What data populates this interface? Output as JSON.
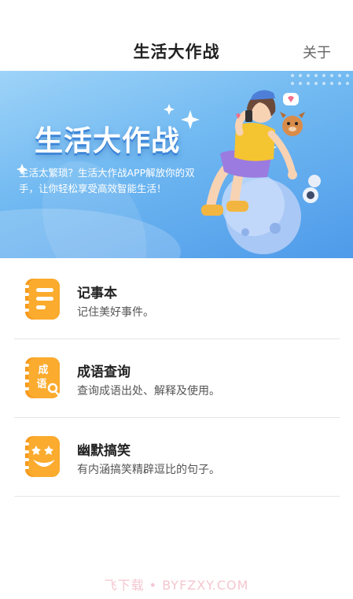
{
  "header": {
    "title": "生活大作战",
    "about_label": "关于"
  },
  "banner": {
    "title": "生活大作战",
    "desc": "生活太繁琐？生活大作战APP解放你的双手，让你轻松享受高效智能生活！"
  },
  "items": [
    {
      "title": "记事本",
      "desc": "记住美好事件。",
      "icon": "notebook-icon"
    },
    {
      "title": "成语查询",
      "desc": "查询成语出处、解释及使用。",
      "icon": "idiom-book-icon",
      "icon_text_1": "成",
      "icon_text_2": "语"
    },
    {
      "title": "幽默搞笑",
      "desc": "有内涵搞笑精辟逗比的句子。",
      "icon": "clown-face-icon"
    }
  ],
  "watermark": "飞下载 • BYFZXY.COM",
  "colors": {
    "accent": "#f79a1e",
    "banner_top": "#9ed3f8",
    "banner_bottom": "#4f9aea"
  }
}
